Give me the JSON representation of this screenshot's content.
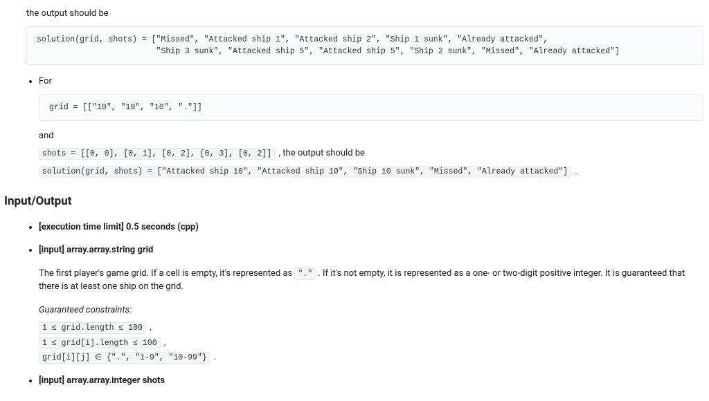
{
  "example1": {
    "intro": "the output should be",
    "code": "solution(grid, shots) = [\"Missed\", \"Attacked ship 1\", \"Attacked ship 2\", \"Ship 1 sunk\", \"Already attacked\",\n                         \"Ship 3 sunk\", \"Attacked ship 5\", \"Attacked ship 5\", \"Ship 2 sunk\", \"Missed\", \"Already attacked\"]"
  },
  "example2": {
    "bullet_label": "For",
    "grid_code": "grid = [[\"10\", \"10\", \"10\", \".\"]]",
    "and_text": "and",
    "shots_inline": "shots = [[0, 0], [0, 1], [0, 2], [0, 3], [0, 2]]",
    "shots_after": ", the output should be",
    "result_inline": "solution(grid, shots) = [\"Attacked ship 10\", \"Attacked ship 10\", \"Ship 10 sunk\", \"Missed\", \"Already attacked\"]",
    "result_after": "."
  },
  "io": {
    "heading": "Input/Output",
    "time_limit": "[execution time limit] 0.5 seconds (cpp)",
    "grid_param": {
      "label": "[input] array.array.string grid",
      "desc_before": "The first player's game grid. If a cell is empty, it's represented as ",
      "dot_code": "\".\"",
      "desc_after": ". If it's not empty, it is represented as a one- or two-digit positive integer. It is guaranteed that there is at least one ship on the grid.",
      "constraints_label": "Guaranteed constraints:",
      "c1": "1 ≤ grid.length ≤ 100",
      "c1_after": ",",
      "c2": "1 ≤ grid[i].length ≤ 100",
      "c2_after": ",",
      "c3": "grid[i][j] ∈ {\".\", \"1-9\", \"10-99\"}",
      "c3_after": "."
    },
    "shots_param": {
      "label": "[input] array.array.integer shots"
    }
  }
}
